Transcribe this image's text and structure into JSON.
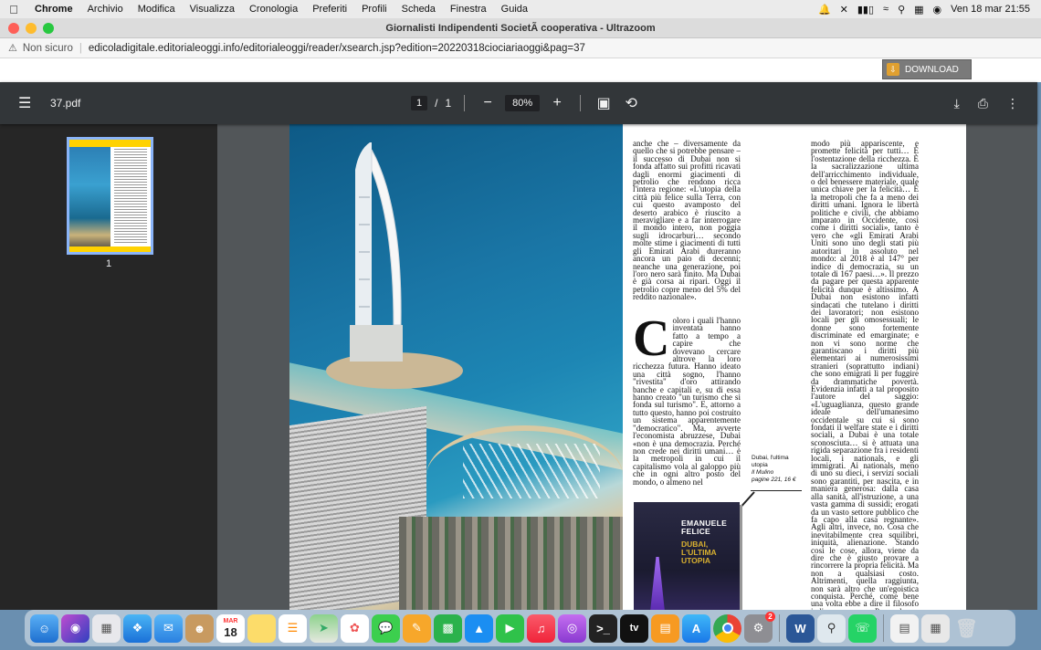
{
  "menubar": {
    "app": "Chrome",
    "items": [
      "Archivio",
      "Modifica",
      "Visualizza",
      "Cronologia",
      "Preferiti",
      "Profili",
      "Scheda",
      "Finestra",
      "Guida"
    ],
    "datetime": "Ven 18 mar  21:55"
  },
  "window": {
    "title": "Giornalisti Indipendenti SocietÃ  cooperativa - Ultrazoom"
  },
  "address": {
    "security": "Non sicuro",
    "url": "edicoladigitale.editorialeoggi.info/editorialeoggi/reader/xsearch.jsp?edition=20220318ciociariaoggi&pag=37"
  },
  "download_button": "DOWNLOAD",
  "pdf_toolbar": {
    "filename": "37.pdf",
    "current_page": "1",
    "page_sep": "/",
    "total_pages": "1",
    "zoom": "80%"
  },
  "thumbnail": {
    "label": "1"
  },
  "article": {
    "col1_top": "anche che – diversamente da quello che si potrebbe pensare – il successo di Dubai non si fonda affatto sui profitti ricavati dagli enormi giacimenti di petrolio che rendono ricca l'intera regione: «L'utopia della città più felice sulla Terra, con cui questo avamposto del deserto arabico è riuscito a meravigliare e a far interrogare il mondo intero, non poggia sugli idrocarburi… secondo molte stime i giacimenti di tutti gli Emirati Arabi dureranno ancora un paio di decenni; neanche una generazione, poi l'oro nero sarà finito. Ma Dubai è già corsa ai ripari. Oggi il petrolio copre meno del 5% del reddito nazionale».",
    "dropcap": "C",
    "col1_bottom": "oloro i quali l'hanno inventata hanno fatto a tempo a capire che dovevano cercare altrove la loro ricchezza futura. Hanno ideato una città sogno, l'hanno \"rivestita\" d'oro attirando banche e capitali e, su di essa hanno creato \"un turismo che si fonda sul turismo\". E, attorno a tutto questo, hanno poi costruito un sistema apparentemente \"democratico\". Ma, avverte l'economista abruzzese, Dubai «non è una democrazia. Perché non crede nei diritti umani… è la metropoli in cui il capitalismo vola al galoppo più che in ogni altro posto del mondo, o almeno nel",
    "col2": "modo più appariscente, e promette felicità per tutti… È l'ostentazione della ricchezza. È la sacralizzazione ultima dell'arricchimento individuale, o del benessere materiale, quale unica chiave per la felicità… È la metropoli che fa a meno dei diritti umani. Ignora le libertà politiche e civili, che abbiamo imparato in Occidente, così come i diritti sociali», tanto è vero che «gli Emirati Arabi Uniti sono uno degli stati più autoritari in assoluto nel mondo: al 2018 è al 147° per indice di democrazia, su un totale di 167 paesi…». Il prezzo da pagare per questa apparente felicità dunque è altissimo. A Dubai non esistono infatti sindacati che tutelano i diritti dei lavoratori; non esistono locali per gli omosessuali; le donne sono fortemente discriminate ed emarginate; e non vi sono norme che garantiscano i diritti più elementari ai numerosissimi stranieri (soprattutto indiani) che sono emigrati lì per fuggire da drammatiche povertà. Evidenzia infatti a tal proposito l'autore del saggio: «L'uguaglianza, questo grande ideale dell'umanesimo occidentale su cui si sono fondati il welfare state e i diritti sociali, a Dubai è una totale sconosciuta… si è attuata una rigida separazione fra i residenti locali, i nationals, e gli immigrati. Ai nationals, meno di uno su dieci, i servizi sociali sono garantiti, per nascita, e in maniera generosa: dalla casa alla sanità, all'istruzione, a una vasta gamma di sussidi; erogati da un vasto settore pubblico che fa capo alla casa regnante». Agli altri, invece, no. Cosa che inevitabilmente crea squilibri, iniquità, alienazione. Stando così le cose, allora, viene da dire che è giusto provare a rincorrere la propria felicità. Ma non a qualsiasi costo. Altrimenti, quella raggiunta, non sarà altro che un'egoistica conquista. Perché, come bene una volta ebbe a dire il filosofo indiano Paramahansa Yogananda, solo",
    "caption_title": "Dubai, l'ultima utopia",
    "caption_pub": "Il Mulino",
    "caption_info": "pagine 221, 16 €",
    "book_author": "EMANUELE FELICE",
    "book_title": "DUBAI, L'ULTIMA UTOPIA"
  },
  "dock": {
    "calendar_month": "MAR",
    "calendar_day": "18",
    "settings_badge": "2",
    "tv_label": "tv",
    "word_label": "W"
  }
}
